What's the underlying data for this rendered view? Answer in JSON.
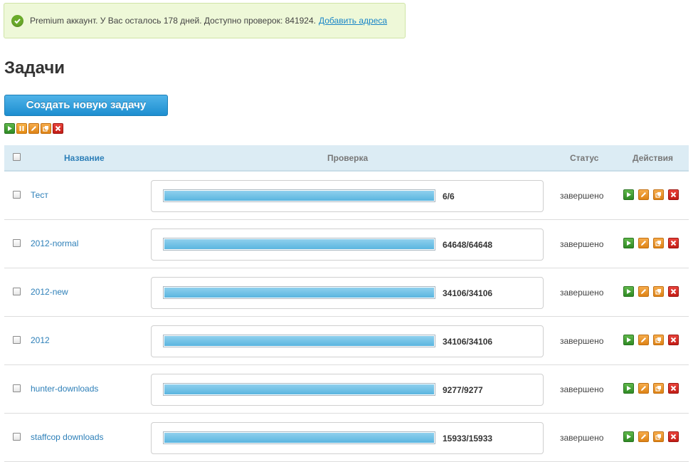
{
  "notice": {
    "text": "Premium аккаунт. У Вас осталось 178 дней. Доступно проверок: 841924.",
    "link": "Добавить адреса"
  },
  "page_title": "Задачи",
  "create_button": "Создать новую задачу",
  "table": {
    "headers": {
      "name": "Название",
      "check": "Проверка",
      "status": "Статус",
      "actions": "Действия"
    },
    "rows": [
      {
        "name": "Тест",
        "count": "6/6",
        "progress": 1.0,
        "status": "завершено"
      },
      {
        "name": "2012-normal",
        "count": "64648/64648",
        "progress": 1.0,
        "status": "завершено"
      },
      {
        "name": "2012-new",
        "count": "34106/34106",
        "progress": 1.0,
        "status": "завершено"
      },
      {
        "name": "2012",
        "count": "34106/34106",
        "progress": 1.0,
        "status": "завершено"
      },
      {
        "name": "hunter-downloads",
        "count": "9277/9277",
        "progress": 1.0,
        "status": "завершено"
      },
      {
        "name": "staffcop downloads",
        "count": "15933/15933",
        "progress": 1.0,
        "status": "завершено"
      }
    ]
  },
  "icons": {
    "play": "play-icon",
    "pause": "pause-icon",
    "edit": "edit-icon",
    "copy": "copy-icon",
    "delete": "delete-icon"
  },
  "colors": {
    "accent": "#1d8ed0",
    "link": "#2d7fb8",
    "progress": "#5ab5e0",
    "success": "#6aab2a",
    "danger": "#c21d16"
  }
}
